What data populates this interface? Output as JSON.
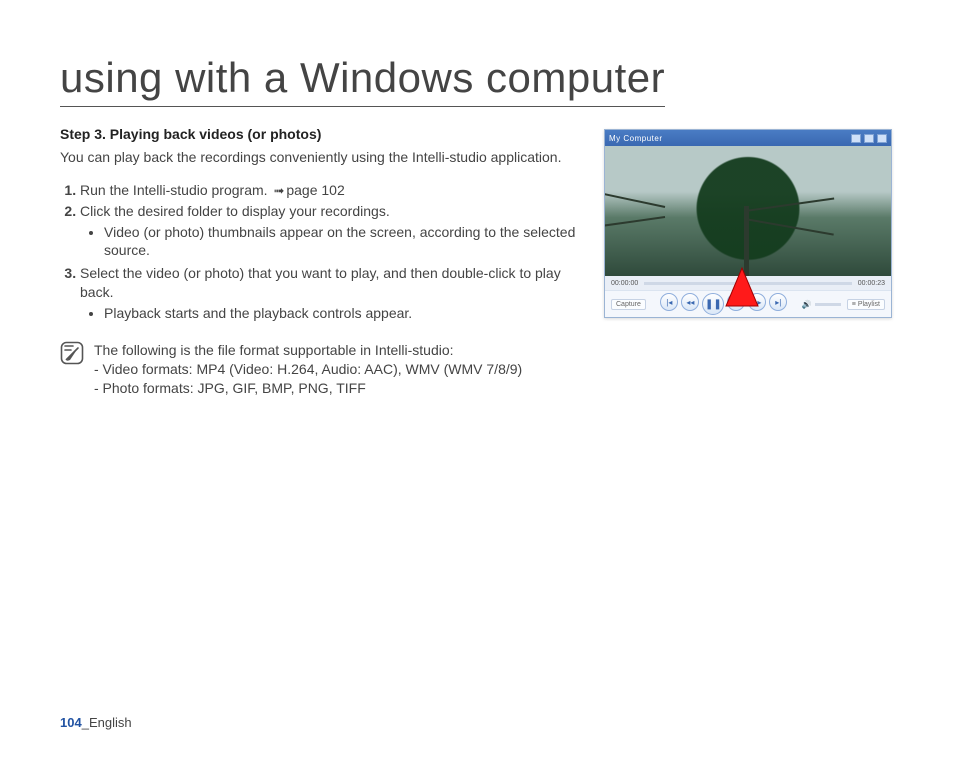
{
  "title": "using with a Windows computer",
  "step_heading": "Step 3. Playing back videos (or photos)",
  "intro": "You can play back the recordings conveniently using the Intelli-studio application.",
  "steps": {
    "s1_a": "Run the Intelli-studio program. ",
    "s1_ref": "page 102",
    "s2": "Click the desired folder to display your recordings.",
    "s2_sub": "Video (or photo) thumbnails appear on the screen, according to the selected source.",
    "s3": "Select the video (or photo) that you want to play, and then double-click to play back.",
    "s3_sub": "Playback starts and the playback controls appear."
  },
  "note": {
    "lead": "The following is the file format supportable in Intelli-studio:",
    "video": "-  Video formats: MP4 (Video: H.264, Audio: AAC), WMV (WMV 7/8/9)",
    "photo": "-  Photo formats: JPG, GIF, BMP, PNG, TIFF"
  },
  "figure": {
    "window_title": "My Computer",
    "time_start": "00:00:00",
    "time_end": "00:00:23",
    "capture": "Capture",
    "playlist": "Playlist"
  },
  "footer": {
    "pageno": "104",
    "sep": "_",
    "lang": "English"
  }
}
